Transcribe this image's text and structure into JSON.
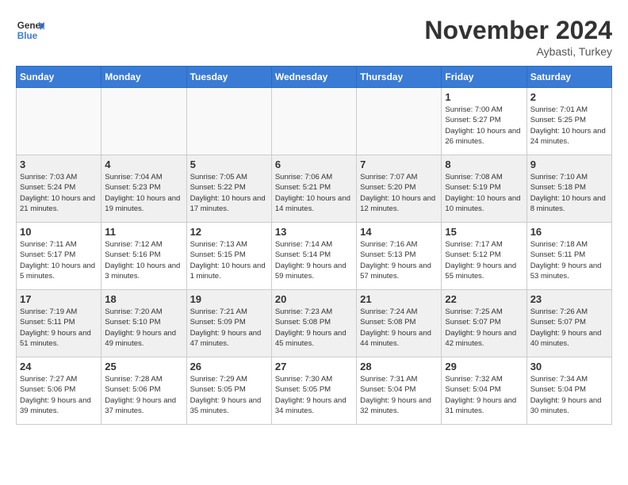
{
  "header": {
    "logo_line1": "General",
    "logo_line2": "Blue",
    "month": "November 2024",
    "location": "Aybasti, Turkey"
  },
  "weekdays": [
    "Sunday",
    "Monday",
    "Tuesday",
    "Wednesday",
    "Thursday",
    "Friday",
    "Saturday"
  ],
  "weeks": [
    [
      {
        "day": "",
        "info": ""
      },
      {
        "day": "",
        "info": ""
      },
      {
        "day": "",
        "info": ""
      },
      {
        "day": "",
        "info": ""
      },
      {
        "day": "",
        "info": ""
      },
      {
        "day": "1",
        "info": "Sunrise: 7:00 AM\nSunset: 5:27 PM\nDaylight: 10 hours and 26 minutes."
      },
      {
        "day": "2",
        "info": "Sunrise: 7:01 AM\nSunset: 5:25 PM\nDaylight: 10 hours and 24 minutes."
      }
    ],
    [
      {
        "day": "3",
        "info": "Sunrise: 7:03 AM\nSunset: 5:24 PM\nDaylight: 10 hours and 21 minutes."
      },
      {
        "day": "4",
        "info": "Sunrise: 7:04 AM\nSunset: 5:23 PM\nDaylight: 10 hours and 19 minutes."
      },
      {
        "day": "5",
        "info": "Sunrise: 7:05 AM\nSunset: 5:22 PM\nDaylight: 10 hours and 17 minutes."
      },
      {
        "day": "6",
        "info": "Sunrise: 7:06 AM\nSunset: 5:21 PM\nDaylight: 10 hours and 14 minutes."
      },
      {
        "day": "7",
        "info": "Sunrise: 7:07 AM\nSunset: 5:20 PM\nDaylight: 10 hours and 12 minutes."
      },
      {
        "day": "8",
        "info": "Sunrise: 7:08 AM\nSunset: 5:19 PM\nDaylight: 10 hours and 10 minutes."
      },
      {
        "day": "9",
        "info": "Sunrise: 7:10 AM\nSunset: 5:18 PM\nDaylight: 10 hours and 8 minutes."
      }
    ],
    [
      {
        "day": "10",
        "info": "Sunrise: 7:11 AM\nSunset: 5:17 PM\nDaylight: 10 hours and 5 minutes."
      },
      {
        "day": "11",
        "info": "Sunrise: 7:12 AM\nSunset: 5:16 PM\nDaylight: 10 hours and 3 minutes."
      },
      {
        "day": "12",
        "info": "Sunrise: 7:13 AM\nSunset: 5:15 PM\nDaylight: 10 hours and 1 minute."
      },
      {
        "day": "13",
        "info": "Sunrise: 7:14 AM\nSunset: 5:14 PM\nDaylight: 9 hours and 59 minutes."
      },
      {
        "day": "14",
        "info": "Sunrise: 7:16 AM\nSunset: 5:13 PM\nDaylight: 9 hours and 57 minutes."
      },
      {
        "day": "15",
        "info": "Sunrise: 7:17 AM\nSunset: 5:12 PM\nDaylight: 9 hours and 55 minutes."
      },
      {
        "day": "16",
        "info": "Sunrise: 7:18 AM\nSunset: 5:11 PM\nDaylight: 9 hours and 53 minutes."
      }
    ],
    [
      {
        "day": "17",
        "info": "Sunrise: 7:19 AM\nSunset: 5:11 PM\nDaylight: 9 hours and 51 minutes."
      },
      {
        "day": "18",
        "info": "Sunrise: 7:20 AM\nSunset: 5:10 PM\nDaylight: 9 hours and 49 minutes."
      },
      {
        "day": "19",
        "info": "Sunrise: 7:21 AM\nSunset: 5:09 PM\nDaylight: 9 hours and 47 minutes."
      },
      {
        "day": "20",
        "info": "Sunrise: 7:23 AM\nSunset: 5:08 PM\nDaylight: 9 hours and 45 minutes."
      },
      {
        "day": "21",
        "info": "Sunrise: 7:24 AM\nSunset: 5:08 PM\nDaylight: 9 hours and 44 minutes."
      },
      {
        "day": "22",
        "info": "Sunrise: 7:25 AM\nSunset: 5:07 PM\nDaylight: 9 hours and 42 minutes."
      },
      {
        "day": "23",
        "info": "Sunrise: 7:26 AM\nSunset: 5:07 PM\nDaylight: 9 hours and 40 minutes."
      }
    ],
    [
      {
        "day": "24",
        "info": "Sunrise: 7:27 AM\nSunset: 5:06 PM\nDaylight: 9 hours and 39 minutes."
      },
      {
        "day": "25",
        "info": "Sunrise: 7:28 AM\nSunset: 5:06 PM\nDaylight: 9 hours and 37 minutes."
      },
      {
        "day": "26",
        "info": "Sunrise: 7:29 AM\nSunset: 5:05 PM\nDaylight: 9 hours and 35 minutes."
      },
      {
        "day": "27",
        "info": "Sunrise: 7:30 AM\nSunset: 5:05 PM\nDaylight: 9 hours and 34 minutes."
      },
      {
        "day": "28",
        "info": "Sunrise: 7:31 AM\nSunset: 5:04 PM\nDaylight: 9 hours and 32 minutes."
      },
      {
        "day": "29",
        "info": "Sunrise: 7:32 AM\nSunset: 5:04 PM\nDaylight: 9 hours and 31 minutes."
      },
      {
        "day": "30",
        "info": "Sunrise: 7:34 AM\nSunset: 5:04 PM\nDaylight: 9 hours and 30 minutes."
      }
    ]
  ]
}
